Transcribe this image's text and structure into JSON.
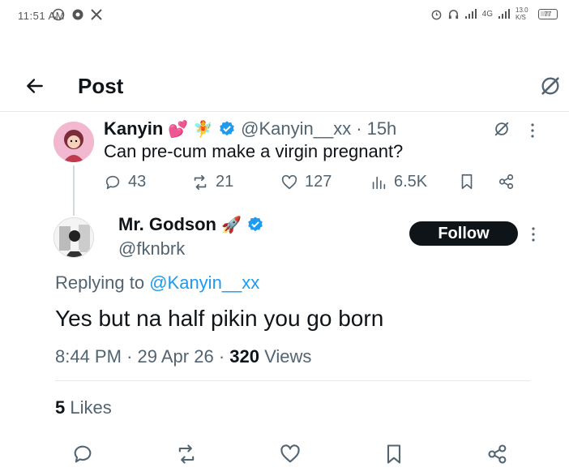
{
  "status_bar": {
    "time": "11:51 AM",
    "network": "4G",
    "speed": "13.0 K/S",
    "battery": "77"
  },
  "header": {
    "title": "Post"
  },
  "parent_tweet": {
    "name": "Kanyin",
    "handle": "@Kanyin__xx",
    "separator": "·",
    "age": "15h",
    "text": "Can pre-cum make a virgin pregnant?",
    "replies": "43",
    "reposts": "21",
    "likes": "127",
    "views": "6.5K"
  },
  "main_tweet": {
    "name": "Mr. Godson",
    "handle": "@fknbrk",
    "follow_label": "Follow",
    "replying_prefix": "Replying to",
    "replying_to": "@Kanyin__xx",
    "text": "Yes but na half pikin you go born",
    "time": "8:44 PM",
    "separator": "·",
    "date": "29 Apr 26",
    "views_count": "320",
    "views_label": "Views",
    "likes_count": "5",
    "likes_label": "Likes"
  },
  "colors": {
    "accent": "#1d9bf0",
    "text": "#0f1419",
    "secondary": "#536471",
    "divider": "#e6e9ec"
  },
  "icons": [
    "back-arrow-icon",
    "grok-icon",
    "verified-badge-icon",
    "reply-icon",
    "repost-icon",
    "like-icon",
    "views-icon",
    "bookmark-icon",
    "share-icon",
    "more-icon"
  ]
}
